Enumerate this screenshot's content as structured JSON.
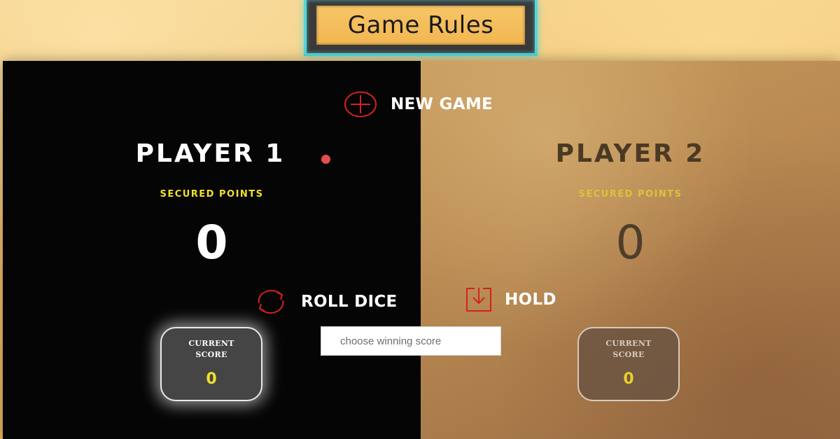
{
  "header": {
    "rules_label": "Game Rules"
  },
  "controls": {
    "new_game_label": "NEW GAME",
    "roll_dice_label": "ROLL DICE",
    "hold_label": "HOLD",
    "icons": {
      "new_game": "plus-circle-icon",
      "roll_dice": "refresh-icon",
      "hold": "download-icon"
    },
    "accent_color": "#d6201f"
  },
  "winning_score": {
    "value": "",
    "placeholder": "choose winning score"
  },
  "players": [
    {
      "name": "PLAYER 1",
      "secured_label": "SECURED POINTS",
      "secured_score": "0",
      "current_label_line1": "CURRENT",
      "current_label_line2": "SCORE",
      "current_score": "0",
      "active": true
    },
    {
      "name": "PLAYER 2",
      "secured_label": "SECURED POINTS",
      "secured_score": "0",
      "current_label_line1": "CURRENT",
      "current_label_line2": "SCORE",
      "current_score": "0",
      "active": false
    }
  ],
  "colors": {
    "active_dot": "#e84c4c",
    "secured_label": "#f2e12a",
    "rules_border": "#57d6d9"
  }
}
